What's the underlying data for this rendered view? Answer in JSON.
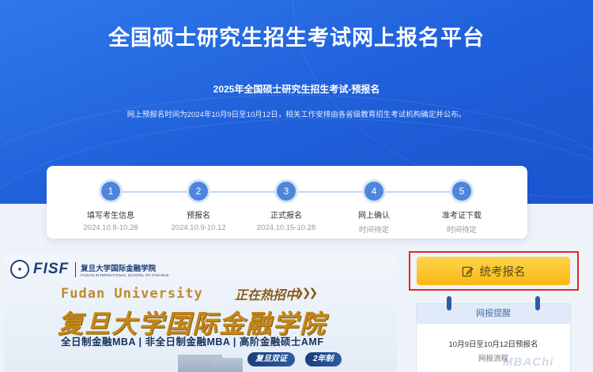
{
  "header": {
    "title": "全国硕士研究生招生考试网上报名平台",
    "subtitle": "2025年全国硕士研究生招生考试-预报名",
    "notice": "网上预报名时间为2024年10月9日至10月12日，相关工作安排由各省级教育招生考试机构确定并公布。"
  },
  "steps": [
    {
      "num": "1",
      "label": "填写考生信息",
      "date": "2024.10.8-10.28"
    },
    {
      "num": "2",
      "label": "预报名",
      "date": "2024.10.9-10.12"
    },
    {
      "num": "3",
      "label": "正式报名",
      "date": "2024.10.15-10.28"
    },
    {
      "num": "4",
      "label": "网上确认",
      "date": "时间待定"
    },
    {
      "num": "5",
      "label": "准考证下载",
      "date": "时间待定"
    }
  ],
  "banner": {
    "logo_mark": "FISF",
    "logo_cn": "复旦大学国际金融学院",
    "logo_en": "FUDAN INTERNATIONAL SCHOOL OF FINANCE",
    "school_en": "Fudan University",
    "hot": "正在热招中",
    "hot_arrows": "❯❯❯",
    "school_cn": "复旦大学国际金融学院",
    "programs": "全日制金融MBA | 非全日制金融MBA | 高阶金融硕士AMF",
    "pill_1": "复旦双证",
    "pill_2": "2年制"
  },
  "actions": {
    "exam_register": "统考报名"
  },
  "reminder": {
    "title": "网报提醒",
    "text": "10月9日至10月12日预报名",
    "sub": "网报流程"
  },
  "watermark": "MBAChi",
  "colors": {
    "hero_blue": "#1f5fd9",
    "step_blue": "#4d86dc",
    "button_yellow": "#fbb716",
    "highlight_red": "#e02828"
  }
}
